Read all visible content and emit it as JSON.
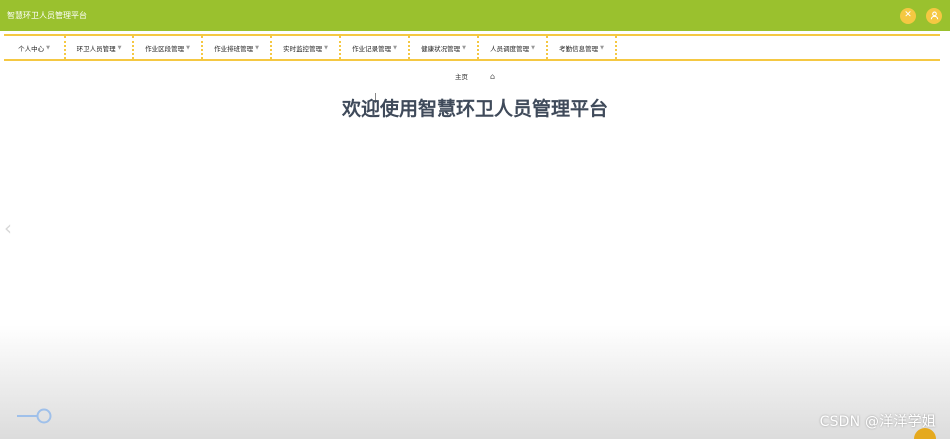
{
  "header": {
    "title": "智慧环卫人员管理平台",
    "icons": [
      "close-icon",
      "user-icon"
    ]
  },
  "nav": {
    "items": [
      {
        "label": "个人中心",
        "width": 62
      },
      {
        "label": "环卫人员管理",
        "width": 68
      },
      {
        "label": "作业区段管理",
        "width": 69
      },
      {
        "label": "作业排班管理",
        "width": 69
      },
      {
        "label": "实时监控管理",
        "width": 69
      },
      {
        "label": "作业记录管理",
        "width": 69
      },
      {
        "label": "健康状况管理",
        "width": 69
      },
      {
        "label": "人员调度管理",
        "width": 69
      },
      {
        "label": "考勤信息管理",
        "width": 69
      }
    ]
  },
  "breadcrumb": {
    "home_label": "主页"
  },
  "main": {
    "welcome_text": "欢迎使用智慧环卫人员管理平台"
  },
  "watermark": "CSDN @洋洋学姐",
  "colors": {
    "header_bg": "#9ac12e",
    "accent": "#f5c842",
    "title_text": "#3f4a5a"
  }
}
